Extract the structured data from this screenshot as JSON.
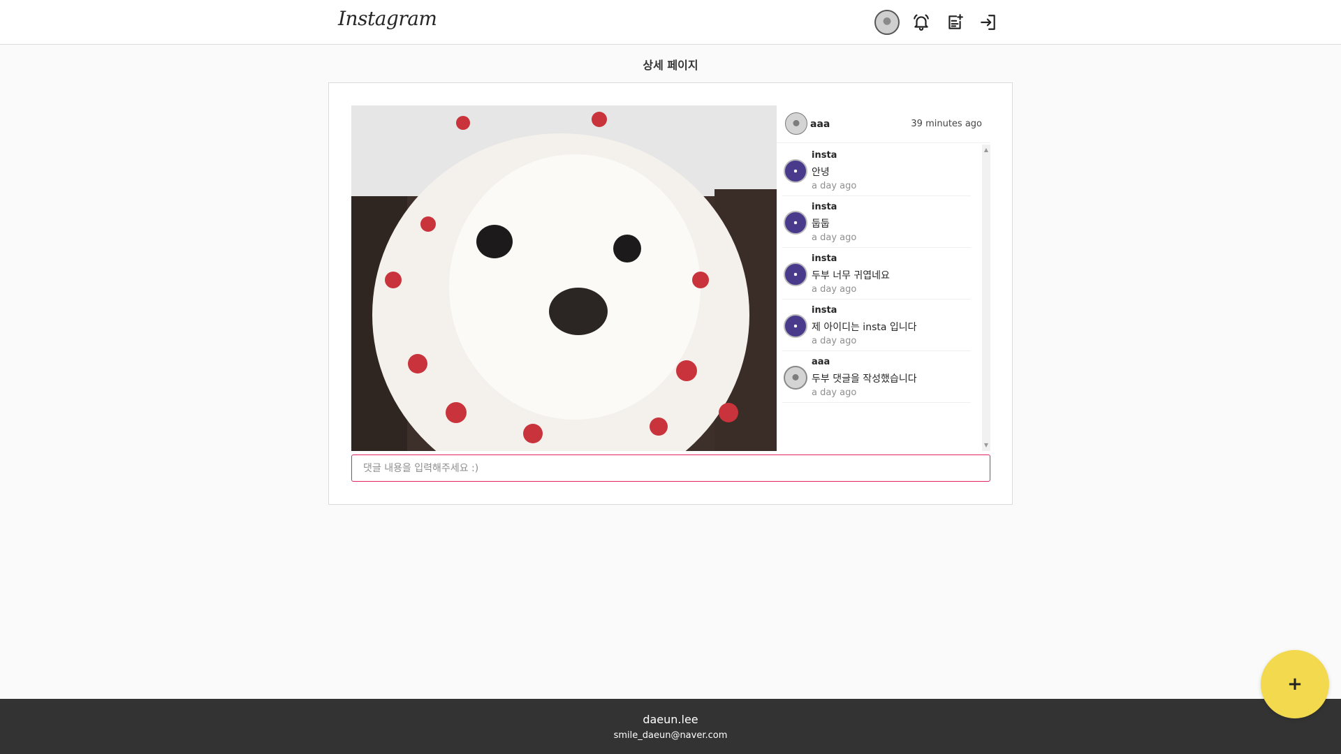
{
  "header": {
    "logo": "Instagram",
    "icons": [
      "avatar",
      "bell-icon",
      "new-post-icon",
      "logout-icon"
    ]
  },
  "page": {
    "title": "상세 페이지"
  },
  "post": {
    "author": "aaa",
    "time": "39 minutes ago"
  },
  "comments": [
    {
      "user": "insta",
      "text": "안녕",
      "time": "a day ago"
    },
    {
      "user": "insta",
      "text": "둡둡",
      "time": "a day ago"
    },
    {
      "user": "insta",
      "text": "두부 너무 귀엽네요",
      "time": "a day ago"
    },
    {
      "user": "insta",
      "text": "제 아이디는 insta 입니다",
      "time": "a day ago"
    },
    {
      "user": "aaa",
      "text": "두부 댓글을 작성했습니다",
      "time": "a day ago"
    }
  ],
  "comment_input": {
    "placeholder": "댓글 내용을 입력해주세요 :)"
  },
  "footer": {
    "name": "daeun.lee",
    "email": "smile_daeun@naver.com"
  },
  "fab": {
    "label": "+"
  },
  "colors": {
    "accent_border": "#e0245e",
    "fab": "#f2d94e",
    "footer": "#333333"
  }
}
